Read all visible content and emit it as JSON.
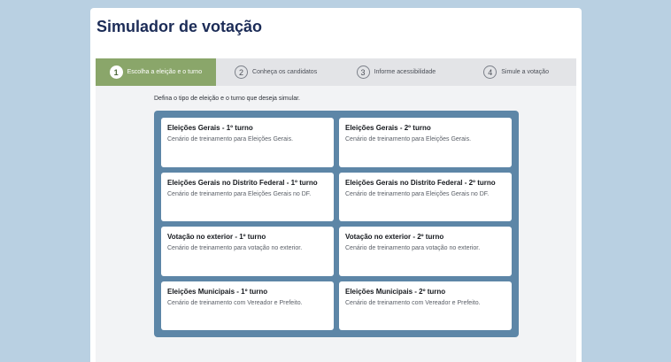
{
  "page_title": "Simulador de votação",
  "steps": [
    {
      "number": "1",
      "label": "Escolha a eleição e o turno"
    },
    {
      "number": "2",
      "label": "Conheça os candidatos"
    },
    {
      "number": "3",
      "label": "Informe acessibilidade"
    },
    {
      "number": "4",
      "label": "Simule a votação"
    }
  ],
  "active_step": 1,
  "instruction": "Defina o tipo de eleição e o turno que deseja simular.",
  "options": [
    {
      "title": "Eleições Gerais - 1º turno",
      "description": "Cenário de treinamento para Eleições Gerais."
    },
    {
      "title": "Eleições Gerais - 2º turno",
      "description": "Cenário de treinamento para Eleições Gerais."
    },
    {
      "title": "Eleições Gerais no Distrito Federal - 1º turno",
      "description": "Cenário de treinamento para Eleições Gerais no DF."
    },
    {
      "title": "Eleições Gerais no Distrito Federal - 2º turno",
      "description": "Cenário de treinamento para Eleições Gerais no DF."
    },
    {
      "title": "Votação no exterior - 1º turno",
      "description": "Cenário de treinamento para votação no exterior."
    },
    {
      "title": "Votação no exterior - 2º turno",
      "description": "Cenário de treinamento para votação no exterior."
    },
    {
      "title": "Eleições Municipais - 1º turno",
      "description": "Cenário de treinamento com Vereador e Prefeito."
    },
    {
      "title": "Eleições Municipais - 2º turno",
      "description": "Cenário de treinamento com Vereador e Prefeito."
    }
  ],
  "colors": {
    "background": "#b9d0e2",
    "active_step": "#8aa66a",
    "options_frame": "#5d86a7",
    "title": "#1c2c57"
  }
}
